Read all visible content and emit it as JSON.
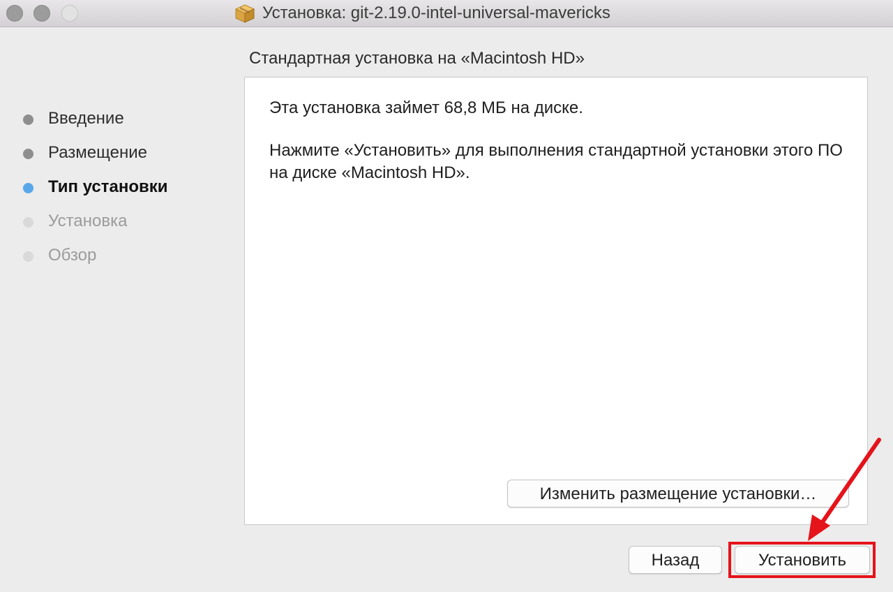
{
  "window": {
    "title": "Установка: git-2.19.0-intel-universal-mavericks",
    "icon": "package-icon"
  },
  "sidebar": {
    "steps": [
      {
        "label": "Введение",
        "state": "done"
      },
      {
        "label": "Размещение",
        "state": "done"
      },
      {
        "label": "Тип установки",
        "state": "current"
      },
      {
        "label": "Установка",
        "state": "pending"
      },
      {
        "label": "Обзор",
        "state": "pending"
      }
    ]
  },
  "main": {
    "section_title": "Стандартная установка на «Macintosh HD»",
    "paragraph_1": "Эта установка займет 68,8 МБ на диске.",
    "paragraph_2": "Нажмите «Установить» для выполнения стандартной установки этого ПО на диске «Macintosh HD».",
    "change_location_label": "Изменить размещение установки…"
  },
  "footer": {
    "back_label": "Назад",
    "install_label": "Установить"
  },
  "colors": {
    "current_step_dot": "#59a7ea",
    "annotation_red": "#e5131a"
  }
}
